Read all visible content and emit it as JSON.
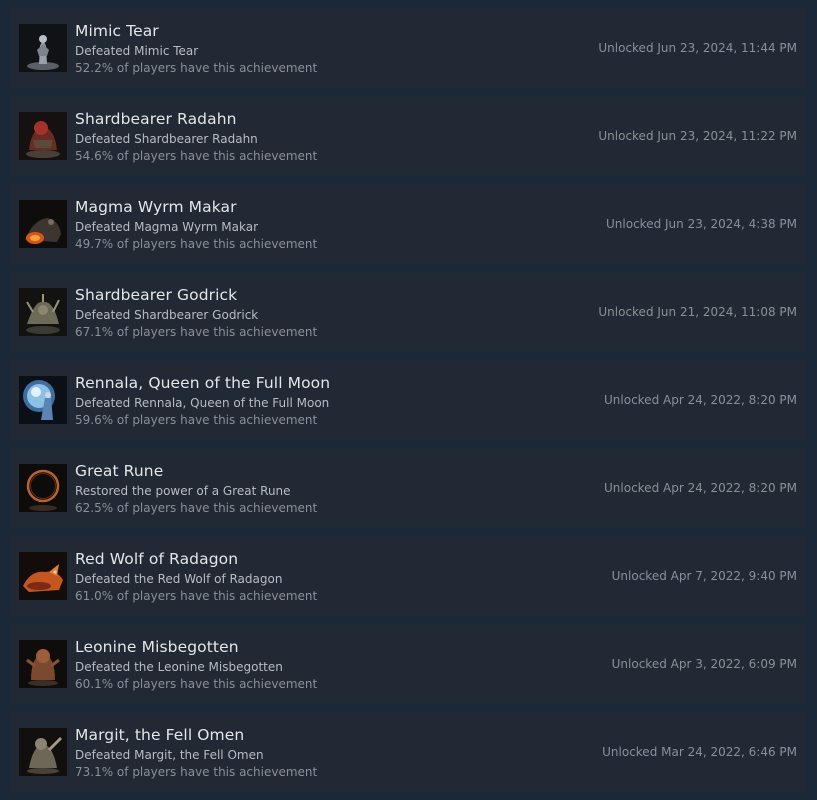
{
  "achievements": [
    {
      "title": "Mimic Tear",
      "description": "Defeated Mimic Tear",
      "percent": "52.2% of players have this achievement",
      "unlocked": "Unlocked Jun 23, 2024, 11:44 PM",
      "icon": "mimic-tear-icon"
    },
    {
      "title": "Shardbearer Radahn",
      "description": "Defeated Shardbearer Radahn",
      "percent": "54.6% of players have this achievement",
      "unlocked": "Unlocked Jun 23, 2024, 11:22 PM",
      "icon": "radahn-icon"
    },
    {
      "title": "Magma Wyrm Makar",
      "description": "Defeated Magma Wyrm Makar",
      "percent": "49.7% of players have this achievement",
      "unlocked": "Unlocked Jun 23, 2024, 4:38 PM",
      "icon": "magma-wyrm-icon"
    },
    {
      "title": "Shardbearer Godrick",
      "description": "Defeated Shardbearer Godrick",
      "percent": "67.1% of players have this achievement",
      "unlocked": "Unlocked Jun 21, 2024, 11:08 PM",
      "icon": "godrick-icon"
    },
    {
      "title": "Rennala, Queen of the Full Moon",
      "description": "Defeated Rennala, Queen of the Full Moon",
      "percent": "59.6% of players have this achievement",
      "unlocked": "Unlocked Apr 24, 2022, 8:20 PM",
      "icon": "rennala-icon"
    },
    {
      "title": "Great Rune",
      "description": "Restored the power of a Great Rune",
      "percent": "62.5% of players have this achievement",
      "unlocked": "Unlocked Apr 24, 2022, 8:20 PM",
      "icon": "great-rune-icon"
    },
    {
      "title": "Red Wolf of Radagon",
      "description": "Defeated the Red Wolf of Radagon",
      "percent": "61.0% of players have this achievement",
      "unlocked": "Unlocked Apr 7, 2022, 9:40 PM",
      "icon": "red-wolf-icon"
    },
    {
      "title": "Leonine Misbegotten",
      "description": "Defeated the Leonine Misbegotten",
      "percent": "60.1% of players have this achievement",
      "unlocked": "Unlocked Apr 3, 2022, 6:09 PM",
      "icon": "leonine-misbegotten-icon"
    },
    {
      "title": "Margit, the Fell Omen",
      "description": "Defeated Margit, the Fell Omen",
      "percent": "73.1% of players have this achievement",
      "unlocked": "Unlocked Mar 24, 2022, 6:46 PM",
      "icon": "margit-icon"
    }
  ],
  "colors": {
    "page_background": "#1b2838",
    "row_background": "#212934",
    "title": "#e4e6e8",
    "description": "#b9bcc0",
    "muted": "#8c9096"
  }
}
